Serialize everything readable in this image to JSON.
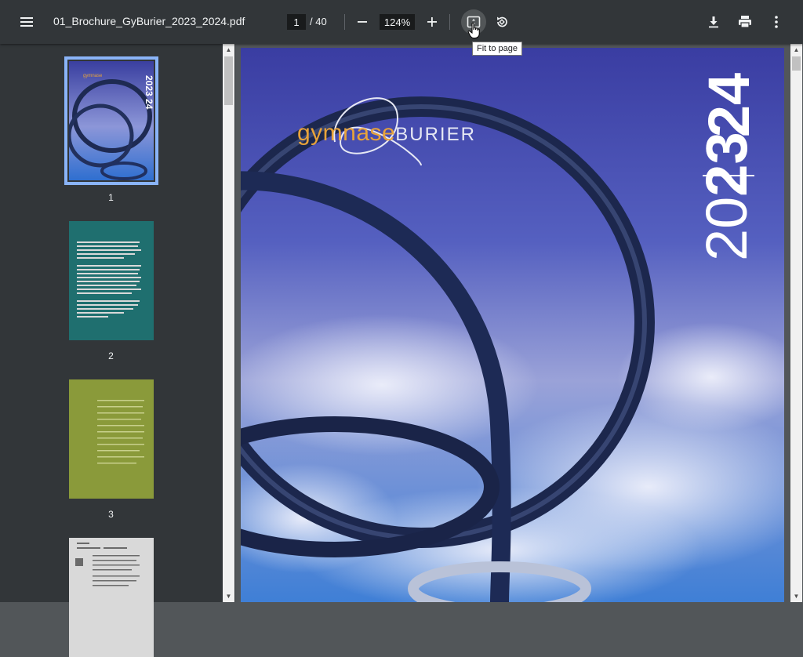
{
  "toolbar": {
    "filename": "01_Brochure_GyBurier_2023_2024.pdf",
    "current_page": "1",
    "total_pages": "/ 40",
    "zoom": "124%",
    "tooltip": "Fit to page",
    "menu_icon": "menu-icon",
    "zoom_out_icon": "minus-icon",
    "zoom_in_icon": "plus-icon",
    "fit_icon": "fit-to-page-icon",
    "rotate_icon": "rotate-icon",
    "download_icon": "download-icon",
    "print_icon": "print-icon",
    "more_icon": "more-vert-icon"
  },
  "sidebar": {
    "thumbnails": [
      {
        "label": "1",
        "color": "#3b4aa6",
        "selected": true
      },
      {
        "label": "2",
        "color": "#1f6f6f",
        "selected": false
      },
      {
        "label": "3",
        "color": "#8a9a3a",
        "selected": false
      },
      {
        "label": "",
        "color": "#d9d9d9",
        "selected": false
      }
    ]
  },
  "document": {
    "brand_a": "gymnase",
    "brand_b": "BURIER",
    "year_top": "24",
    "year_bottom_bold": "23",
    "year_bottom_light": "20",
    "colors": {
      "sky_top": "#3a3fa0",
      "sky_mid": "#5b6fc9",
      "brand_orange": "#e8a33a",
      "metal": "#1e2a52"
    }
  },
  "theme": {
    "toolbar_bg": "#323639",
    "viewer_bg": "#525659",
    "accent": "#8ab4f8"
  }
}
